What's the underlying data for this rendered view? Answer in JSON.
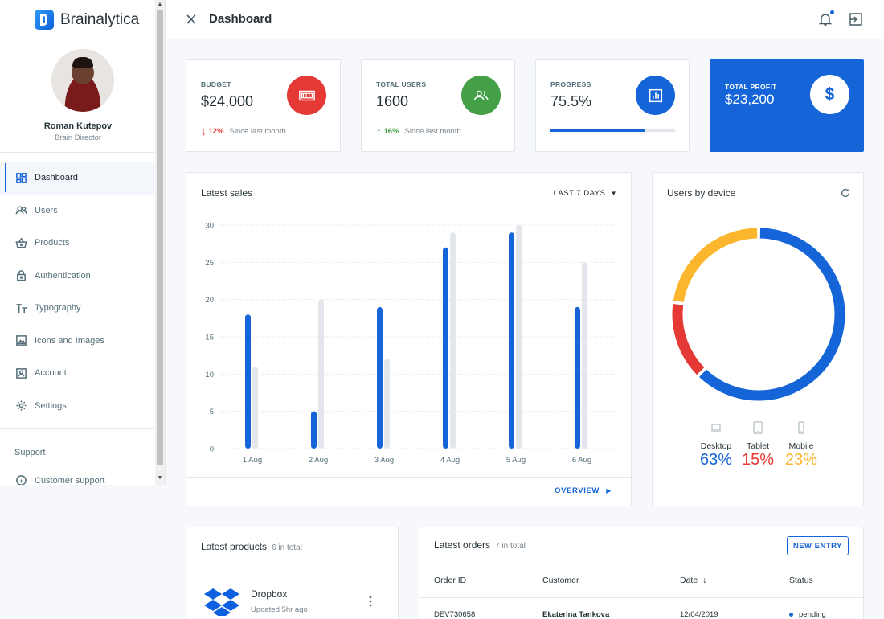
{
  "app": {
    "name": "Brainalytica",
    "page_title": "Dashboard"
  },
  "profile": {
    "name": "Roman Kutepov",
    "role": "Brain Director"
  },
  "nav": {
    "items": [
      {
        "label": "Dashboard",
        "icon": "dashboard-icon",
        "active": true
      },
      {
        "label": "Users",
        "icon": "users-icon"
      },
      {
        "label": "Products",
        "icon": "basket-icon"
      },
      {
        "label": "Authentication",
        "icon": "lock-icon"
      },
      {
        "label": "Typography",
        "icon": "text-icon"
      },
      {
        "label": "Icons and Images",
        "icon": "image-icon"
      },
      {
        "label": "Account",
        "icon": "account-icon"
      },
      {
        "label": "Settings",
        "icon": "gear-icon"
      }
    ],
    "support_title": "Support",
    "support_item": "Customer support"
  },
  "stats": {
    "budget": {
      "label": "BUDGET",
      "value": "$24,000",
      "change": "12%",
      "since": "Since last month",
      "color": "#e53935"
    },
    "users": {
      "label": "TOTAL USERS",
      "value": "1600",
      "change": "16%",
      "since": "Since last month",
      "color": "#43a047"
    },
    "progress": {
      "label": "PROGRESS",
      "value": "75.5%",
      "fraction": 0.755
    },
    "profit": {
      "label": "TOTAL PROFIT",
      "value": "$23,200"
    }
  },
  "sales": {
    "title": "Latest sales",
    "range": "LAST 7 DAYS",
    "overview": "OVERVIEW"
  },
  "devices": {
    "title": "Users by device",
    "items": [
      {
        "name": "Desktop",
        "pct": "63%",
        "color": "#1565d8"
      },
      {
        "name": "Tablet",
        "pct": "15%",
        "color": "#e53935"
      },
      {
        "name": "Mobile",
        "pct": "23%",
        "color": "#fbb62d"
      }
    ]
  },
  "products": {
    "title": "Latest products",
    "count": "6 in total",
    "first": {
      "name": "Dropbox",
      "updated": "Updated 5hr ago"
    }
  },
  "orders": {
    "title": "Latest orders",
    "count": "7 in total",
    "new_entry": "NEW ENTRY",
    "headers": {
      "id": "Order ID",
      "customer": "Customer",
      "date": "Date",
      "status": "Status"
    },
    "rows": [
      {
        "id": "DEV730658",
        "customer": "Ekaterina Tankova",
        "date": "12/04/2019",
        "status": "pending"
      }
    ]
  },
  "chart_data": {
    "type": "bar",
    "title": "Latest sales",
    "categories": [
      "1 Aug",
      "2 Aug",
      "3 Aug",
      "4 Aug",
      "5 Aug",
      "6 Aug"
    ],
    "series": [
      {
        "values": [
          18,
          5,
          19,
          27,
          29,
          19
        ],
        "color": "#1565d8"
      },
      {
        "values": [
          11,
          20,
          12,
          29,
          30,
          25
        ],
        "color": "#e3e6ea"
      }
    ],
    "yticks": [
      0,
      5,
      10,
      15,
      20,
      25,
      30
    ],
    "ylim": [
      0,
      30
    ],
    "grid": true
  }
}
